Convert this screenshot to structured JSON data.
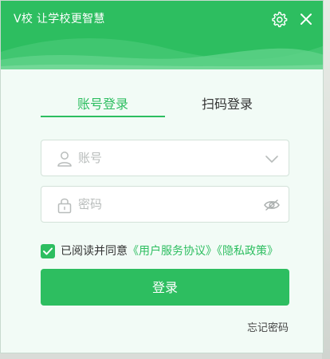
{
  "header": {
    "title": "V校 让学校更智慧",
    "settings_icon": "gear-icon",
    "close_icon": "close-icon"
  },
  "tabs": [
    {
      "label": "账号登录",
      "active": true
    },
    {
      "label": "扫码登录",
      "active": false
    }
  ],
  "account": {
    "placeholder": "账号",
    "value": "",
    "icon": "user-icon",
    "dropdown_icon": "chevron-down-icon"
  },
  "password": {
    "placeholder": "密码",
    "value": "",
    "icon": "lock-icon",
    "visibility_icon": "eye-icon"
  },
  "agreement": {
    "checked": true,
    "prefix": "已阅读并同意",
    "terms_link": "《用户服务协议》",
    "privacy_link": "《隐私政策》"
  },
  "login_button": "登录",
  "forgot_password": "忘记密码",
  "colors": {
    "accent": "#2dbe60",
    "background": "#f2fbf6"
  }
}
